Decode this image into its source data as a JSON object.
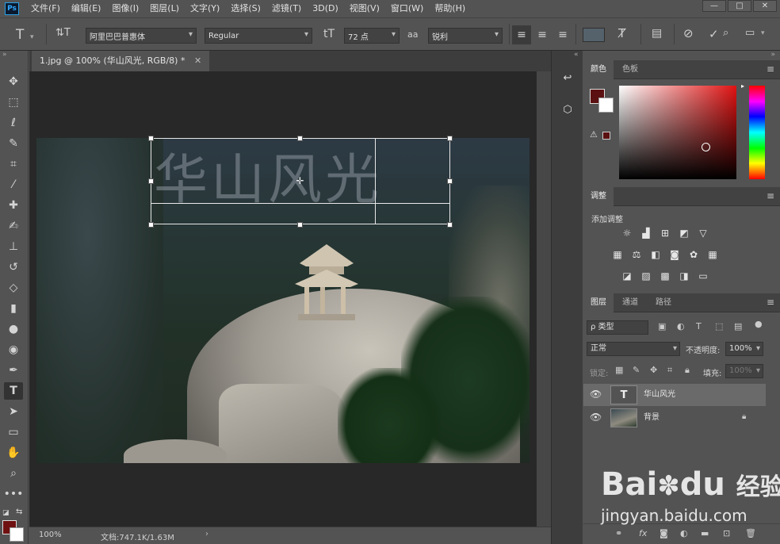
{
  "app": {
    "logo": "Ps"
  },
  "menu": [
    "文件(F)",
    "编辑(E)",
    "图像(I)",
    "图层(L)",
    "文字(Y)",
    "选择(S)",
    "滤镜(T)",
    "3D(D)",
    "视图(V)",
    "窗口(W)",
    "帮助(H)"
  ],
  "window_controls": [
    "—",
    "□",
    "✕"
  ],
  "options": {
    "tool_icon": "T",
    "orient_icon": "⇅T",
    "font_family": "阿里巴巴普惠体",
    "font_style": "Regular",
    "size_icon": "tT",
    "font_size": "72 点",
    "aa_icon": "aa",
    "anti_alias": "锐利",
    "text_color": "#55626c"
  },
  "document": {
    "tab_title": "1.jpg @ 100% (华山风光, RGB/8) *",
    "text_content": "华山风光",
    "zoom": "100%",
    "doc_info": "文档:747.1K/1.63M"
  },
  "panels": {
    "color_tabs": [
      "颜色",
      "色板"
    ],
    "adjust_tab": "调整",
    "adjust_title": "添加调整",
    "layers_tabs": [
      "图层",
      "通道",
      "路径"
    ],
    "filter_label": "ρ 类型",
    "blend_mode": "正常",
    "opacity_label": "不透明度:",
    "opacity_value": "100%",
    "lock_label": "锁定:",
    "fill_label": "填充:",
    "fill_value": "100%",
    "layers": [
      {
        "name": "华山风光",
        "type": "text",
        "selected": true
      },
      {
        "name": "背景",
        "type": "image",
        "locked": true
      }
    ]
  },
  "colors": {
    "foreground": "#6f1111",
    "background": "#ffffff",
    "accent": "#31a8ff"
  },
  "watermark": {
    "brand": "Bai",
    "brand2": "du",
    "cn": "经验",
    "url": "jingyan.baidu.com"
  }
}
